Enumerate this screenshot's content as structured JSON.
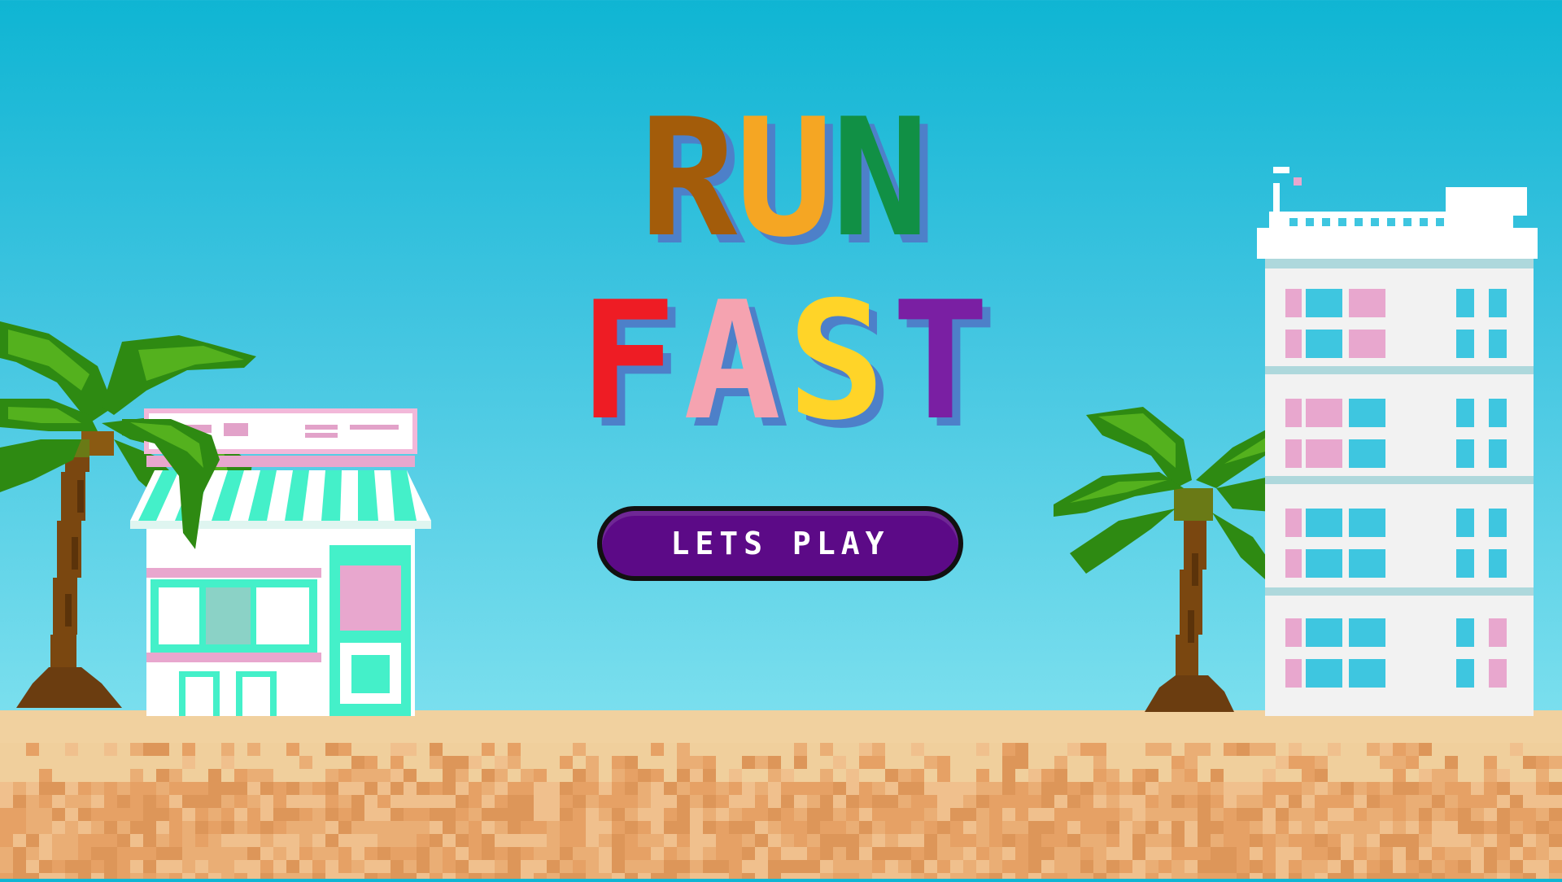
{
  "title": {
    "word1": [
      {
        "char": "R",
        "color": "#a35c0a"
      },
      {
        "char": "U",
        "color": "#f5a623"
      },
      {
        "char": "N",
        "color": "#119045"
      }
    ],
    "word2": [
      {
        "char": "F",
        "color": "#ee1c24"
      },
      {
        "char": "A",
        "color": "#f5a3b0"
      },
      {
        "char": "S",
        "color": "#ffd428"
      },
      {
        "char": "T",
        "color": "#7a1fa3"
      }
    ],
    "shadow_color": "#4d80c9"
  },
  "play_button": {
    "label": "LETS PLAY",
    "color": "#5c0a87"
  },
  "scene": {
    "sky_color": "#0fb5d3",
    "sand_color": "#e6a165",
    "icons": [
      "palm-tree-icon",
      "shop-building-icon",
      "hotel-building-icon"
    ]
  }
}
